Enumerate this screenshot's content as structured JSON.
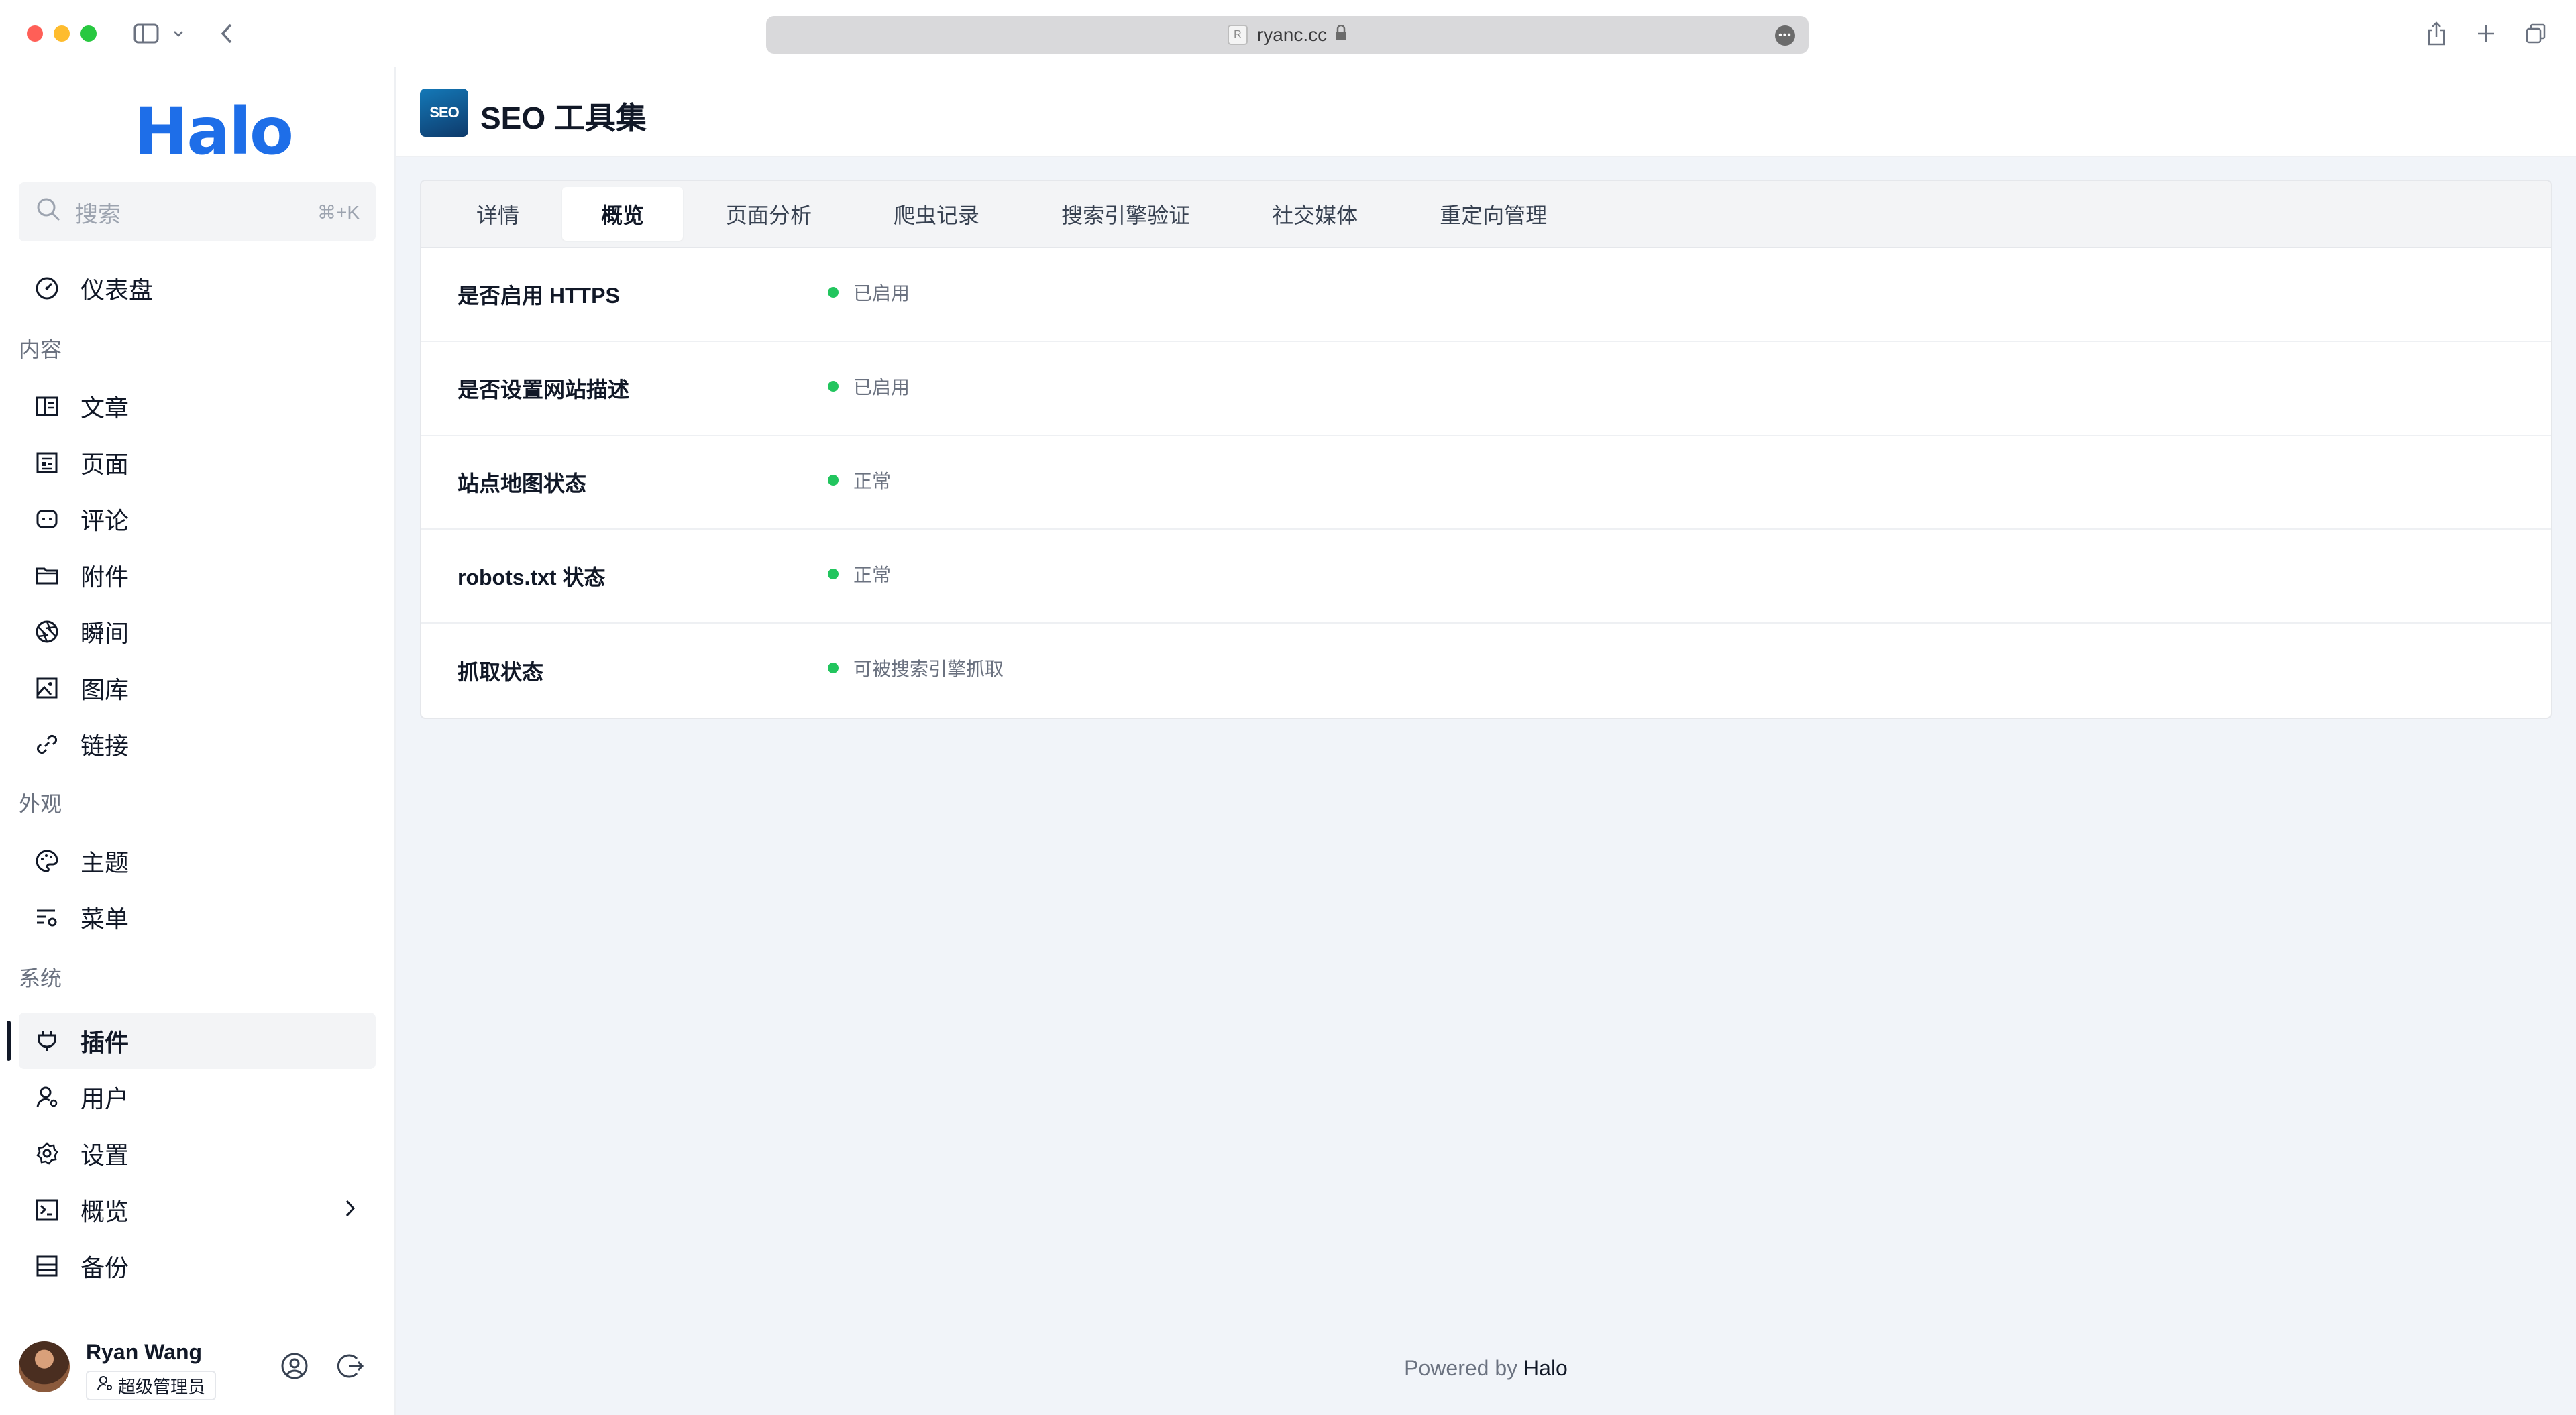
{
  "browser": {
    "url": "ryanc.cc",
    "favicon_text": "R"
  },
  "sidebar": {
    "logo": "Halo",
    "search": {
      "placeholder": "搜索",
      "shortcut": "⌘+K"
    },
    "dashboard": "仪表盘",
    "groups": {
      "content": "内容",
      "appearance": "外观",
      "system": "系统"
    },
    "content_items": [
      "文章",
      "页面",
      "评论",
      "附件",
      "瞬间",
      "图库",
      "链接"
    ],
    "appearance_items": [
      "主题",
      "菜单"
    ],
    "system_items": [
      "插件",
      "用户",
      "设置",
      "概览",
      "备份"
    ],
    "user": {
      "name": "Ryan Wang",
      "role": "超级管理员"
    }
  },
  "header": {
    "icon_text": "SEO",
    "title": "SEO 工具集"
  },
  "tabs": [
    "详情",
    "概览",
    "页面分析",
    "爬虫记录",
    "搜索引擎验证",
    "社交媒体",
    "重定向管理"
  ],
  "active_tab": "概览",
  "overview_rows": [
    {
      "label": "是否启用 HTTPS",
      "status": "已启用"
    },
    {
      "label": "是否设置网站描述",
      "status": "已启用"
    },
    {
      "label": "站点地图状态",
      "status": "正常"
    },
    {
      "label": "robots.txt 状态",
      "status": "正常"
    },
    {
      "label": "抓取状态",
      "status": "可被搜索引擎抓取"
    }
  ],
  "footer": {
    "prefix": "Powered by",
    "brand": "Halo"
  },
  "colors": {
    "accent": "#1e6ee8",
    "status_ok": "#22c55e"
  }
}
